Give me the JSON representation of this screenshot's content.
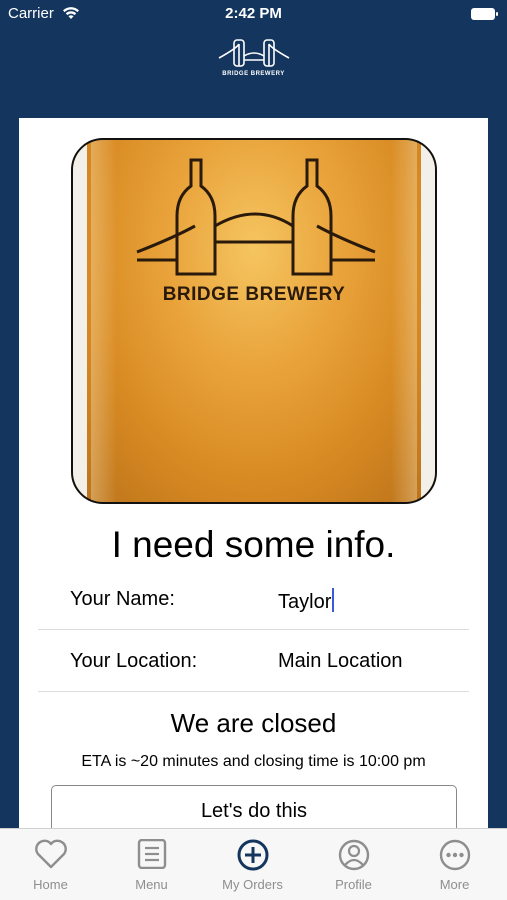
{
  "status": {
    "carrier": "Carrier",
    "time": "2:42 PM"
  },
  "header": {
    "brand": "BRIDGE BREWERY"
  },
  "hero": {
    "brand": "BRIDGE BREWERY"
  },
  "form": {
    "title": "I need some info.",
    "name_label": "Your Name:",
    "name_value": "Taylor",
    "location_label": "Your Location:",
    "location_value": "Main Location",
    "status_title": "We are closed",
    "eta_text": "ETA is ~20 minutes and closing time is 10:00 pm",
    "submit_label": "Let's do this"
  },
  "tabs": [
    {
      "label": "Home",
      "icon": "heart-icon"
    },
    {
      "label": "Menu",
      "icon": "menu-list-icon"
    },
    {
      "label": "My Orders",
      "icon": "plus-circle-icon"
    },
    {
      "label": "Profile",
      "icon": "profile-icon"
    },
    {
      "label": "More",
      "icon": "more-icon"
    }
  ],
  "colors": {
    "navy": "#14355e",
    "active_tab": "#14355e",
    "inactive_tab": "#8e8e8e"
  }
}
